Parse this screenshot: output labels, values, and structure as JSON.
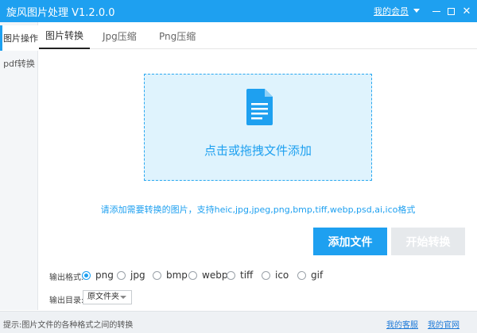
{
  "app": {
    "title": "旋风图片处理 V1.2.0.0",
    "member_link": "我的会员",
    "accent_color": "#1ea0f0"
  },
  "window_controls": {
    "minimize_icon": "minimize-icon",
    "maximize_icon": "maximize-icon",
    "close_icon": "close-icon",
    "close_glyph": "✕"
  },
  "sidebar": {
    "items": [
      {
        "label": "图片操作",
        "active": true
      },
      {
        "label": "pdf转换",
        "active": false
      }
    ]
  },
  "tabs": [
    {
      "label": "图片转换",
      "active": true
    },
    {
      "label": "Jpg压缩",
      "active": false
    },
    {
      "label": "Png压缩",
      "active": false
    }
  ],
  "dropzone": {
    "icon": "document-icon",
    "text": "点击或拖拽文件添加"
  },
  "support_text": "请添加需要转换的图片，支持heic,jpg,jpeg,png,bmp,tiff,webp,psd,ai,ico格式",
  "buttons": {
    "add_file": "添加文件",
    "start_convert": "开始转换"
  },
  "output_format": {
    "label": "输出格式:",
    "options": [
      "png",
      "jpg",
      "bmp",
      "webp",
      "tiff",
      "ico",
      "gif"
    ],
    "selected": "png"
  },
  "output_dir": {
    "label": "输出目录:",
    "selected": "原文件夹"
  },
  "status": {
    "tip": "提示:图片文件的各种格式之间的转换",
    "service_link": "我的客服",
    "website_link": "我的官网"
  }
}
